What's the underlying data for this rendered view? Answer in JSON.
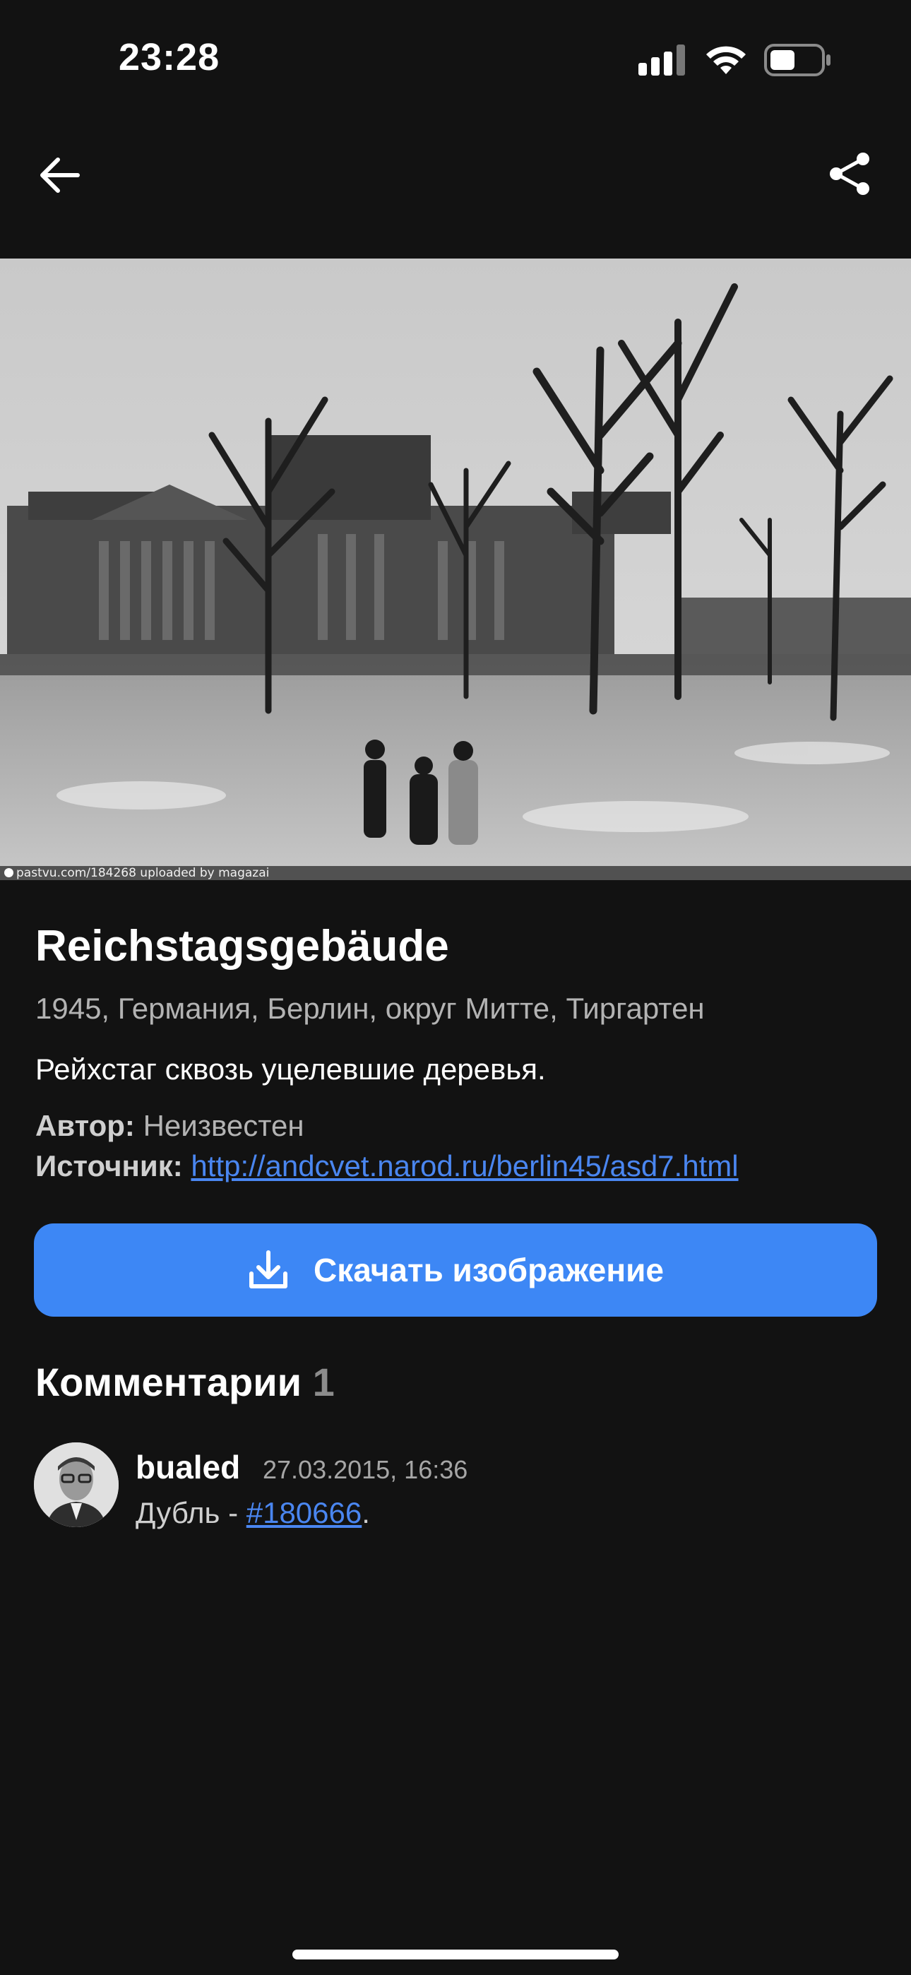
{
  "status_bar": {
    "time": "23:28",
    "icons": [
      "cellular-signal-icon",
      "wifi-icon",
      "battery-icon"
    ]
  },
  "nav": {
    "back_icon": "arrow-left-icon",
    "share_icon": "share-icon"
  },
  "photo": {
    "watermark": "pastvu.com/184268  uploaded by magazai"
  },
  "details": {
    "title": "Reichstagsgebäude",
    "subtitle": "1945, Германия, Берлин, округ Митте, Тиргартен",
    "description": "Рейхстаг сквозь уцелевшие деревья.",
    "author_label": "Автор:",
    "author_value": "Неизвестен",
    "source_label": "Источник:",
    "source_link": "http://andcvet.narod.ru/berlin45/asd7.html"
  },
  "download": {
    "label": "Скачать изображение",
    "icon": "download-icon"
  },
  "comments": {
    "heading": "Комментарии",
    "count": "1",
    "items": [
      {
        "author": "bualed",
        "date": "27.03.2015, 16:36",
        "text_prefix": "Дубль - ",
        "link": "#180666",
        "text_suffix": "."
      }
    ]
  },
  "colors": {
    "background": "#121212",
    "accent": "#3d87f5",
    "link": "#4a86f0",
    "secondary_text": "#b3b3b3"
  }
}
